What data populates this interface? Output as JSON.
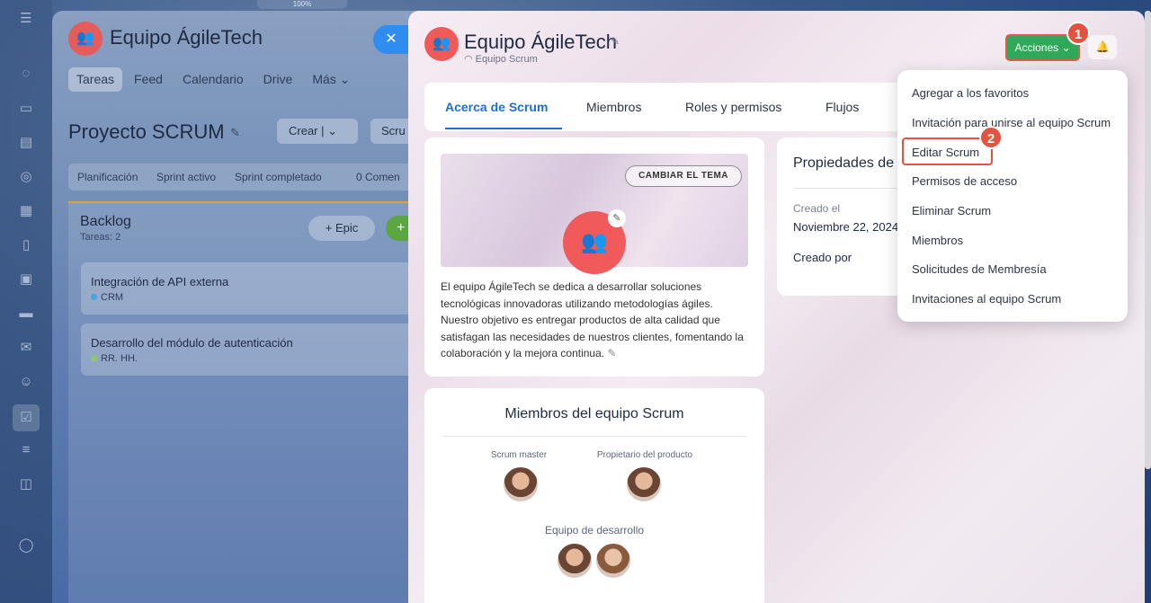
{
  "top_indicator": "100%",
  "background_window": {
    "group_title": "Equipo ÁgileTech",
    "tabs": [
      "Tareas",
      "Feed",
      "Calendario",
      "Drive",
      "Más ⌄"
    ],
    "project_title": "Proyecto SCRUM",
    "create_label": "Crear  |  ⌄",
    "scrum_label": "Scru",
    "filters": [
      "Planificación",
      "Sprint activo",
      "Sprint completado",
      "0  Comen"
    ],
    "backlog": {
      "title": "Backlog",
      "subtitle": "Tareas: 2",
      "epic_label": "+ Epic",
      "add_label": "+"
    },
    "cards": [
      {
        "title": "Integración de API externa",
        "tag": "CRM",
        "tag_color": "#4aa3df"
      },
      {
        "title": "Desarrollo del módulo de autenticación",
        "tag": "RR. HH.",
        "tag_color": "#8fc66a"
      }
    ]
  },
  "panel": {
    "title": "Equipo ÁgileTech",
    "subtitle": "Equipo Scrum",
    "actions_label": "Acciones ⌄",
    "tabs": [
      "Acerca de Scrum",
      "Miembros",
      "Roles y permisos",
      "Flujos"
    ],
    "about": {
      "theme_button": "CAMBIAR EL TEMA",
      "description": "El equipo ÁgileTech se dedica a desarrollar soluciones tecnológicas innovadoras utilizando metodologías ágiles. Nuestro objetivo es entregar productos de alta calidad que satisfagan las necesidades de nuestros clientes, fomentando la colaboración y la mejora continua."
    },
    "properties": {
      "title": "Propiedades de",
      "created_label": "Creado el",
      "created_value": "Noviembre 22, 2024",
      "created_by_label": "Creado por"
    },
    "members": {
      "title": "Miembros del equipo Scrum",
      "scrum_master": "Scrum master",
      "product_owner": "Propietario del producto",
      "dev_team": "Equipo de desarrollo"
    }
  },
  "dropdown": {
    "items": [
      "Agregar a los favoritos",
      "Invitación para unirse al equipo Scrum",
      "Editar Scrum",
      "Permisos de acceso",
      "Eliminar Scrum",
      "Miembros",
      "Solicitudes de Membresía",
      "Invitaciones al equipo Scrum"
    ]
  },
  "markers": [
    "1",
    "2"
  ],
  "colors": {
    "accent_green": "#2fa85a",
    "marker_red": "#e3533f",
    "link_blue": "#1f6fd1",
    "logo_red": "#f05a5a"
  }
}
